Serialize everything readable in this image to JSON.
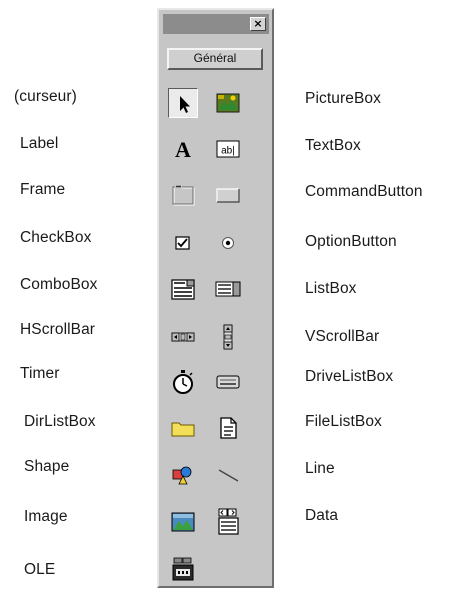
{
  "toolbox": {
    "close_symbol": "×",
    "tab_label": "Général"
  },
  "labels": {
    "pointer": "(curseur)",
    "picturebox": "PictureBox",
    "label": "Label",
    "textbox": "TextBox",
    "frame": "Frame",
    "commandbutton": "CommandButton",
    "checkbox": "CheckBox",
    "optionbutton": "OptionButton",
    "combobox": "ComboBox",
    "listbox": "ListBox",
    "hscrollbar": "HScrollBar",
    "vscrollbar": "VScrollBar",
    "timer": "Timer",
    "drivelistbox": "DriveListBox",
    "dirlistbox": "DirListBox",
    "filelistbox": "FileListBox",
    "shape": "Shape",
    "line": "Line",
    "image": "Image",
    "data": "Data",
    "ole": "OLE"
  },
  "icons": {
    "label_glyph": "A",
    "textbox_glyph": "ab|"
  }
}
